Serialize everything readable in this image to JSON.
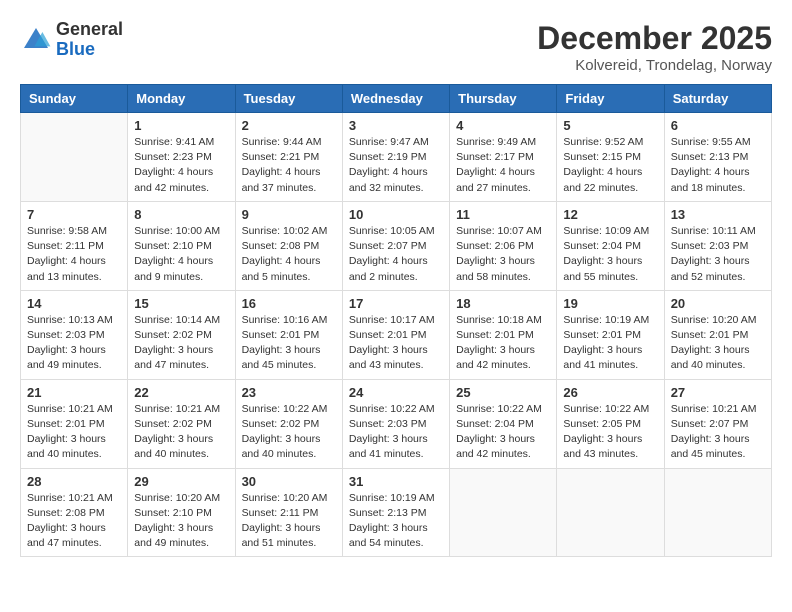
{
  "header": {
    "logo_general": "General",
    "logo_blue": "Blue",
    "month_title": "December 2025",
    "location": "Kolvereid, Trondelag, Norway"
  },
  "calendar": {
    "days_of_week": [
      "Sunday",
      "Monday",
      "Tuesday",
      "Wednesday",
      "Thursday",
      "Friday",
      "Saturday"
    ],
    "weeks": [
      [
        {
          "day": "",
          "info": ""
        },
        {
          "day": "1",
          "info": "Sunrise: 9:41 AM\nSunset: 2:23 PM\nDaylight: 4 hours\nand 42 minutes."
        },
        {
          "day": "2",
          "info": "Sunrise: 9:44 AM\nSunset: 2:21 PM\nDaylight: 4 hours\nand 37 minutes."
        },
        {
          "day": "3",
          "info": "Sunrise: 9:47 AM\nSunset: 2:19 PM\nDaylight: 4 hours\nand 32 minutes."
        },
        {
          "day": "4",
          "info": "Sunrise: 9:49 AM\nSunset: 2:17 PM\nDaylight: 4 hours\nand 27 minutes."
        },
        {
          "day": "5",
          "info": "Sunrise: 9:52 AM\nSunset: 2:15 PM\nDaylight: 4 hours\nand 22 minutes."
        },
        {
          "day": "6",
          "info": "Sunrise: 9:55 AM\nSunset: 2:13 PM\nDaylight: 4 hours\nand 18 minutes."
        }
      ],
      [
        {
          "day": "7",
          "info": "Sunrise: 9:58 AM\nSunset: 2:11 PM\nDaylight: 4 hours\nand 13 minutes."
        },
        {
          "day": "8",
          "info": "Sunrise: 10:00 AM\nSunset: 2:10 PM\nDaylight: 4 hours\nand 9 minutes."
        },
        {
          "day": "9",
          "info": "Sunrise: 10:02 AM\nSunset: 2:08 PM\nDaylight: 4 hours\nand 5 minutes."
        },
        {
          "day": "10",
          "info": "Sunrise: 10:05 AM\nSunset: 2:07 PM\nDaylight: 4 hours\nand 2 minutes."
        },
        {
          "day": "11",
          "info": "Sunrise: 10:07 AM\nSunset: 2:06 PM\nDaylight: 3 hours\nand 58 minutes."
        },
        {
          "day": "12",
          "info": "Sunrise: 10:09 AM\nSunset: 2:04 PM\nDaylight: 3 hours\nand 55 minutes."
        },
        {
          "day": "13",
          "info": "Sunrise: 10:11 AM\nSunset: 2:03 PM\nDaylight: 3 hours\nand 52 minutes."
        }
      ],
      [
        {
          "day": "14",
          "info": "Sunrise: 10:13 AM\nSunset: 2:03 PM\nDaylight: 3 hours\nand 49 minutes."
        },
        {
          "day": "15",
          "info": "Sunrise: 10:14 AM\nSunset: 2:02 PM\nDaylight: 3 hours\nand 47 minutes."
        },
        {
          "day": "16",
          "info": "Sunrise: 10:16 AM\nSunset: 2:01 PM\nDaylight: 3 hours\nand 45 minutes."
        },
        {
          "day": "17",
          "info": "Sunrise: 10:17 AM\nSunset: 2:01 PM\nDaylight: 3 hours\nand 43 minutes."
        },
        {
          "day": "18",
          "info": "Sunrise: 10:18 AM\nSunset: 2:01 PM\nDaylight: 3 hours\nand 42 minutes."
        },
        {
          "day": "19",
          "info": "Sunrise: 10:19 AM\nSunset: 2:01 PM\nDaylight: 3 hours\nand 41 minutes."
        },
        {
          "day": "20",
          "info": "Sunrise: 10:20 AM\nSunset: 2:01 PM\nDaylight: 3 hours\nand 40 minutes."
        }
      ],
      [
        {
          "day": "21",
          "info": "Sunrise: 10:21 AM\nSunset: 2:01 PM\nDaylight: 3 hours\nand 40 minutes."
        },
        {
          "day": "22",
          "info": "Sunrise: 10:21 AM\nSunset: 2:02 PM\nDaylight: 3 hours\nand 40 minutes."
        },
        {
          "day": "23",
          "info": "Sunrise: 10:22 AM\nSunset: 2:02 PM\nDaylight: 3 hours\nand 40 minutes."
        },
        {
          "day": "24",
          "info": "Sunrise: 10:22 AM\nSunset: 2:03 PM\nDaylight: 3 hours\nand 41 minutes."
        },
        {
          "day": "25",
          "info": "Sunrise: 10:22 AM\nSunset: 2:04 PM\nDaylight: 3 hours\nand 42 minutes."
        },
        {
          "day": "26",
          "info": "Sunrise: 10:22 AM\nSunset: 2:05 PM\nDaylight: 3 hours\nand 43 minutes."
        },
        {
          "day": "27",
          "info": "Sunrise: 10:21 AM\nSunset: 2:07 PM\nDaylight: 3 hours\nand 45 minutes."
        }
      ],
      [
        {
          "day": "28",
          "info": "Sunrise: 10:21 AM\nSunset: 2:08 PM\nDaylight: 3 hours\nand 47 minutes."
        },
        {
          "day": "29",
          "info": "Sunrise: 10:20 AM\nSunset: 2:10 PM\nDaylight: 3 hours\nand 49 minutes."
        },
        {
          "day": "30",
          "info": "Sunrise: 10:20 AM\nSunset: 2:11 PM\nDaylight: 3 hours\nand 51 minutes."
        },
        {
          "day": "31",
          "info": "Sunrise: 10:19 AM\nSunset: 2:13 PM\nDaylight: 3 hours\nand 54 minutes."
        },
        {
          "day": "",
          "info": ""
        },
        {
          "day": "",
          "info": ""
        },
        {
          "day": "",
          "info": ""
        }
      ]
    ]
  }
}
